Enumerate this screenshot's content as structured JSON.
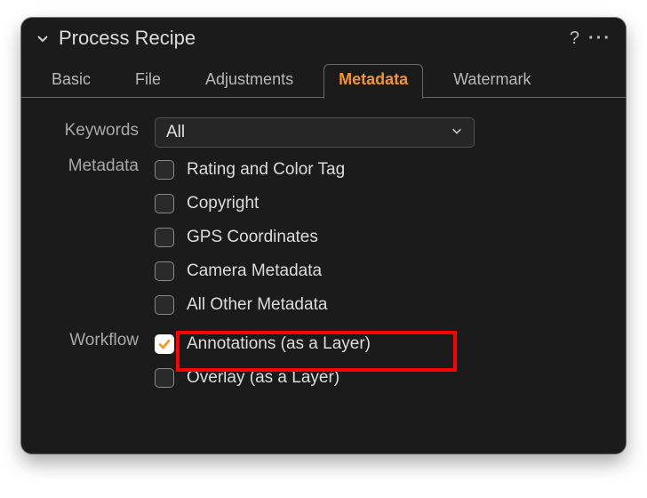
{
  "header": {
    "title": "Process Recipe",
    "help_label": "?",
    "more_label": "···"
  },
  "tabs": [
    {
      "label": "Basic",
      "active": false
    },
    {
      "label": "File",
      "active": false
    },
    {
      "label": "Adjustments",
      "active": false
    },
    {
      "label": "Metadata",
      "active": true
    },
    {
      "label": "Watermark",
      "active": false
    }
  ],
  "sections": {
    "keywords": {
      "label": "Keywords",
      "select_value": "All"
    },
    "metadata": {
      "label": "Metadata",
      "items": [
        {
          "label": "Rating and Color Tag",
          "checked": false
        },
        {
          "label": "Copyright",
          "checked": false
        },
        {
          "label": "GPS Coordinates",
          "checked": false
        },
        {
          "label": "Camera Metadata",
          "checked": false
        },
        {
          "label": "All Other Metadata",
          "checked": false
        }
      ]
    },
    "workflow": {
      "label": "Workflow",
      "items": [
        {
          "label": "Annotations (as a Layer)",
          "checked": true,
          "highlighted": true
        },
        {
          "label": "Overlay (as a Layer)",
          "checked": false,
          "highlighted": false
        }
      ]
    }
  },
  "colors": {
    "accent": "#f59423",
    "highlight_box": "#ff0000"
  }
}
